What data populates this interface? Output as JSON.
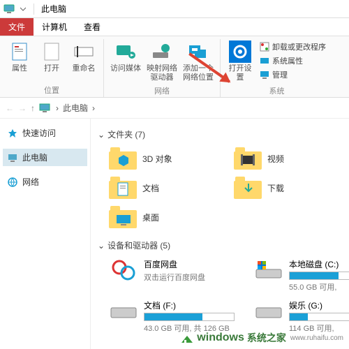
{
  "titlebar": {
    "title": "此电脑"
  },
  "tabs": {
    "file": "文件",
    "computer": "计算机",
    "view": "查看"
  },
  "ribbon": {
    "group1": {
      "label": "位置",
      "properties": "属性",
      "open": "打开",
      "rename": "重命名"
    },
    "group2": {
      "label": "网络",
      "media": "访问媒体",
      "map": "映射网络驱动器",
      "addnet": "添加一个网络位置"
    },
    "group3": {
      "label": "系统",
      "opensettings": "打开设置",
      "uninstall": "卸载或更改程序",
      "sysprops": "系统属性",
      "manage": "管理"
    }
  },
  "breadcrumb": {
    "root": "此电脑",
    "sep": "›"
  },
  "sidebar": {
    "quick": "快速访问",
    "thispc": "此电脑",
    "network": "网络"
  },
  "sections": {
    "folders": {
      "header": "文件夹 (7)"
    },
    "drives": {
      "header": "设备和驱动器 (5)"
    }
  },
  "folders": {
    "f3d": "3D 对象",
    "video": "视频",
    "docs": "文档",
    "downloads": "下载",
    "desktop": "桌面"
  },
  "drives": {
    "baidu": {
      "name": "百度网盘",
      "sub": "双击运行百度网盘"
    },
    "c": {
      "name": "本地磁盘 (C:)",
      "sub": "55.0 GB 可用,"
    },
    "f": {
      "name": "文档 (F:)",
      "sub": "43.0 GB 可用, 共 126 GB"
    },
    "g": {
      "name": "娱乐 (G:)",
      "sub": "114 GB 可用,"
    }
  },
  "watermark": {
    "brand": "windows",
    "suffix": "系统之家",
    "url": "www.ruhaifu.com"
  }
}
